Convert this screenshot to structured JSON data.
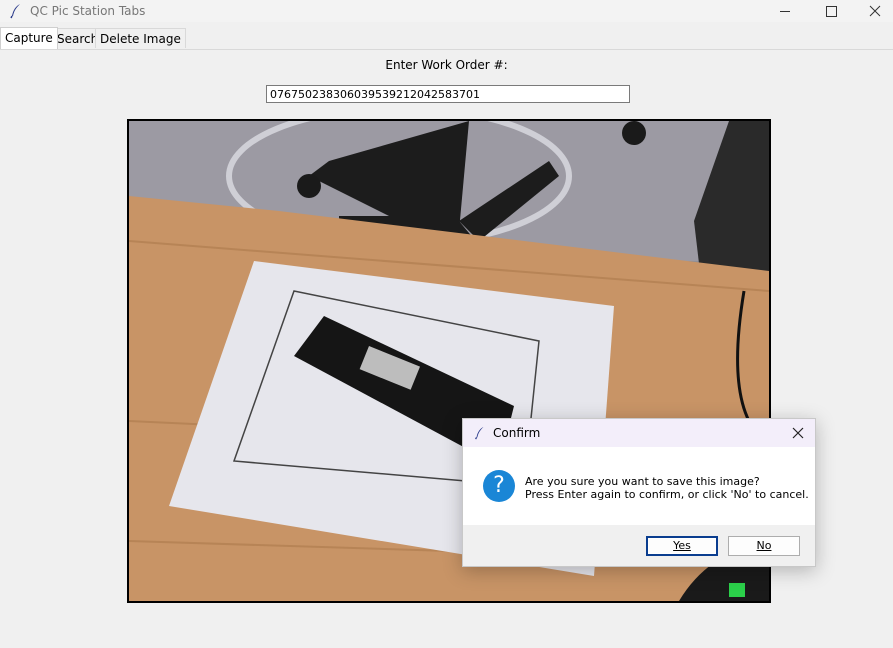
{
  "window": {
    "title": "QC Pic Station Tabs",
    "icon": "feather-icon"
  },
  "tabs": [
    {
      "label": "Capture",
      "active": true
    },
    {
      "label": "Search",
      "active": false
    },
    {
      "label": "Delete Image",
      "active": false
    }
  ],
  "capture": {
    "prompt": "Enter Work Order #:",
    "work_order_value": "076750238306039539212042583701"
  },
  "dialog": {
    "title": "Confirm",
    "icon": "question-icon",
    "message_line1": "Are you sure you want to save this image?",
    "message_line2": "Press Enter again to confirm, or click 'No' to cancel.",
    "yes_label": "Yes",
    "no_label": "No"
  }
}
